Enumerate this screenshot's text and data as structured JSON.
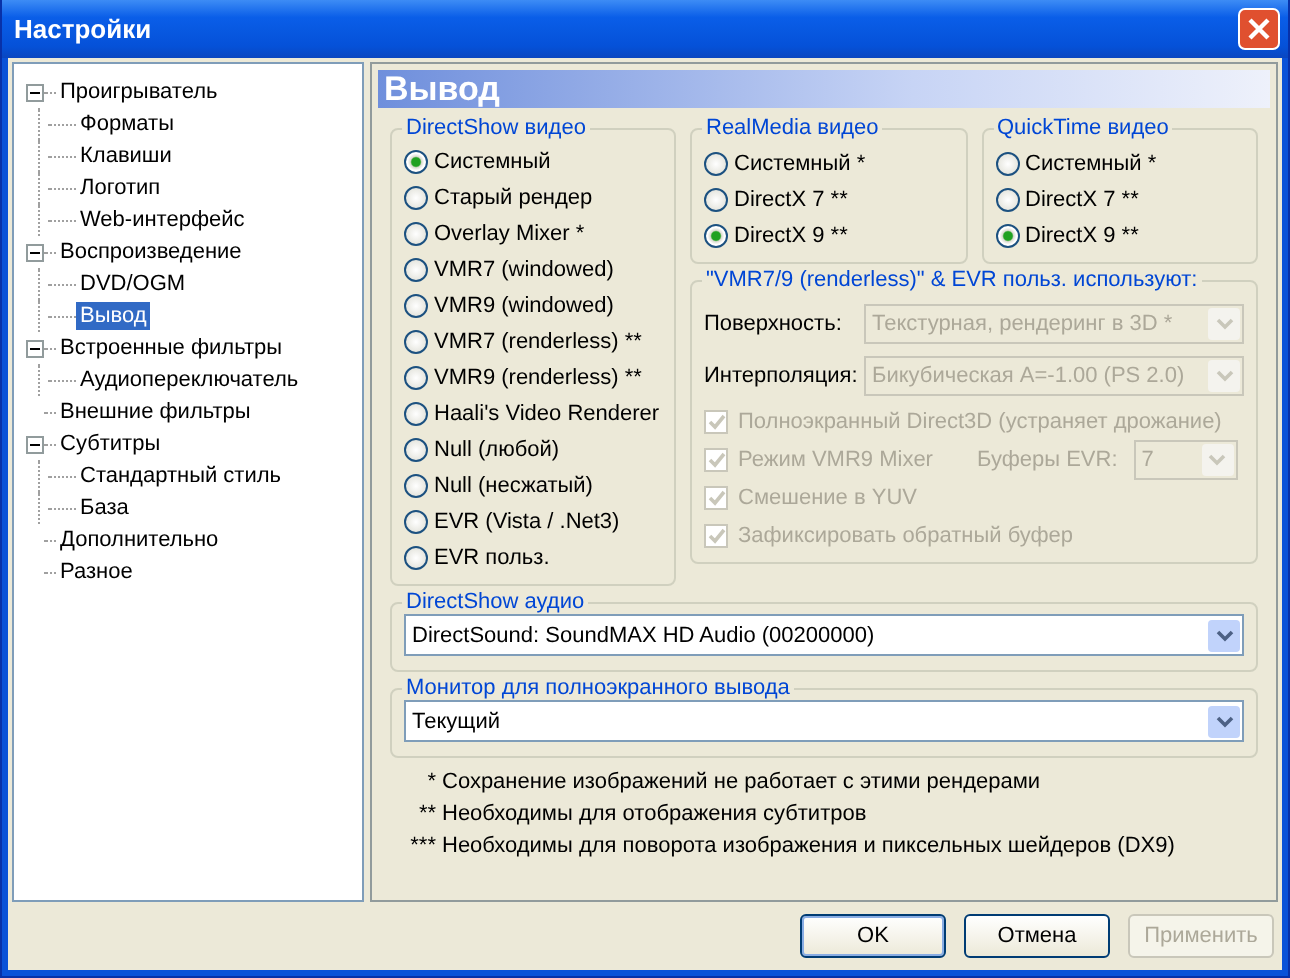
{
  "window": {
    "title": "Настройки"
  },
  "tree": [
    {
      "label": "Проигрыватель",
      "expanded": true,
      "selected": false,
      "children": [
        {
          "label": "Форматы",
          "selected": false
        },
        {
          "label": "Клавиши",
          "selected": false
        },
        {
          "label": "Логотип",
          "selected": false
        },
        {
          "label": "Web-интерфейс",
          "selected": false
        }
      ]
    },
    {
      "label": "Воспроизведение",
      "expanded": true,
      "selected": false,
      "children": [
        {
          "label": "DVD/OGM",
          "selected": false
        },
        {
          "label": "Вывод",
          "selected": true
        }
      ]
    },
    {
      "label": "Встроенные фильтры",
      "expanded": true,
      "selected": false,
      "children": [
        {
          "label": "Аудиопереключатель",
          "selected": false
        }
      ]
    },
    {
      "label": "Внешние фильтры",
      "selected": false
    },
    {
      "label": "Субтитры",
      "expanded": true,
      "selected": false,
      "children": [
        {
          "label": "Стандартный стиль",
          "selected": false
        },
        {
          "label": "База",
          "selected": false
        }
      ]
    },
    {
      "label": "Дополнительно",
      "selected": false
    },
    {
      "label": "Разное",
      "selected": false
    }
  ],
  "page_title": "Вывод",
  "directshow_video": {
    "title": "DirectShow видео",
    "options": [
      {
        "label": "Системный",
        "selected": true
      },
      {
        "label": "Старый рендер",
        "selected": false
      },
      {
        "label": "Overlay Mixer *",
        "selected": false
      },
      {
        "label": "VMR7 (windowed)",
        "selected": false
      },
      {
        "label": "VMR9 (windowed)",
        "selected": false
      },
      {
        "label": "VMR7 (renderless) **",
        "selected": false
      },
      {
        "label": "VMR9 (renderless) **",
        "selected": false
      },
      {
        "label": "Haali's Video Renderer",
        "selected": false
      },
      {
        "label": "Null (любой)",
        "selected": false
      },
      {
        "label": "Null (несжатый)",
        "selected": false
      },
      {
        "label": "EVR (Vista / .Net3)",
        "selected": false
      },
      {
        "label": "EVR польз.",
        "selected": false
      }
    ]
  },
  "realmedia_video": {
    "title": "RealMedia видео",
    "options": [
      {
        "label": "Системный *",
        "selected": false
      },
      {
        "label": "DirectX 7 **",
        "selected": false
      },
      {
        "label": "DirectX 9 **",
        "selected": true
      }
    ]
  },
  "quicktime_video": {
    "title": "QuickTime видео",
    "options": [
      {
        "label": "Системный *",
        "selected": false
      },
      {
        "label": "DirectX 7 **",
        "selected": false
      },
      {
        "label": "DirectX 9 **",
        "selected": true
      }
    ]
  },
  "renderless": {
    "title": "\"VMR7/9 (renderless)\" & EVR польз. используют:",
    "fields": [
      {
        "label": "Поверхность:",
        "value": "Текстурная, рендеринг в 3D *",
        "disabled": true
      },
      {
        "label": "Интерполяция:",
        "value": "Бикубическая A=-1.00 (PS 2.0)",
        "disabled": true
      }
    ],
    "checkboxes": [
      {
        "label": "Полноэкранный Direct3D (устраняет дрожание)",
        "checked": true,
        "disabled": true
      },
      {
        "label": "Режим VMR9 Mixer",
        "checked": true,
        "disabled": true
      },
      {
        "label": "Смешение в YUV",
        "checked": true,
        "disabled": true
      },
      {
        "label": "Зафиксировать обратный буфер",
        "checked": true,
        "disabled": true
      }
    ],
    "evr_buffers": {
      "label": "Буферы EVR:",
      "value": "7",
      "disabled": true
    }
  },
  "directshow_audio": {
    "title": "DirectShow аудио",
    "value": "DirectSound: SoundMAX HD Audio (00200000)"
  },
  "fullscreen_monitor": {
    "title": "Монитор для полноэкранного вывода",
    "value": "Текущий"
  },
  "notes": [
    {
      "mark": "*",
      "text": "Сохранение изображений не работает с этими рендерами"
    },
    {
      "mark": "**",
      "text": "Необходимы для отображения субтитров"
    },
    {
      "mark": "***",
      "text": "Необходимы для поворота изображения и пиксельных шейдеров (DX9)"
    }
  ],
  "buttons": [
    {
      "label": "OK",
      "default": true,
      "disabled": false
    },
    {
      "label": "Отмена",
      "default": false,
      "disabled": false
    },
    {
      "label": "Применить",
      "default": false,
      "disabled": true
    }
  ]
}
